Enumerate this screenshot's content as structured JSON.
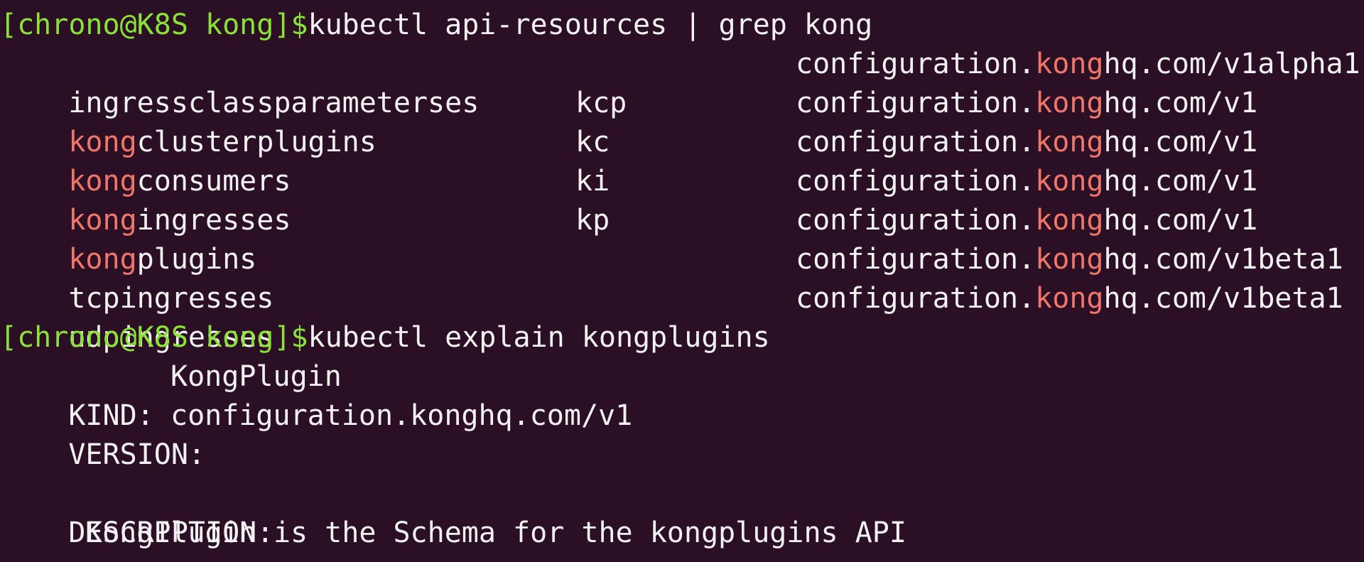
{
  "colors": {
    "background": "#2b0f24",
    "text": "#f2f2f2",
    "prompt": "#8ae234",
    "match_highlight": "#f0766a"
  },
  "prompt": "[chrono@K8S kong]$",
  "command1": "kubectl api-resources | grep kong",
  "match": "kong",
  "rows": [
    {
      "pre": "ingressclassparameterses",
      "name_match": "",
      "name_rest": "",
      "short": "",
      "api_pre": "configuration.",
      "api_match": "kong",
      "api_rest": "hq.com/v1alpha1"
    },
    {
      "pre": "",
      "name_match": "kong",
      "name_rest": "clusterplugins",
      "short": "kcp",
      "api_pre": "configuration.",
      "api_match": "kong",
      "api_rest": "hq.com/v1"
    },
    {
      "pre": "",
      "name_match": "kong",
      "name_rest": "consumers",
      "short": "kc",
      "api_pre": "configuration.",
      "api_match": "kong",
      "api_rest": "hq.com/v1"
    },
    {
      "pre": "",
      "name_match": "kong",
      "name_rest": "ingresses",
      "short": "ki",
      "api_pre": "configuration.",
      "api_match": "kong",
      "api_rest": "hq.com/v1"
    },
    {
      "pre": "",
      "name_match": "kong",
      "name_rest": "plugins",
      "short": "kp",
      "api_pre": "configuration.",
      "api_match": "kong",
      "api_rest": "hq.com/v1"
    },
    {
      "pre": "tcpingresses",
      "name_match": "",
      "name_rest": "",
      "short": "",
      "api_pre": "configuration.",
      "api_match": "kong",
      "api_rest": "hq.com/v1beta1"
    },
    {
      "pre": "udpingresses",
      "name_match": "",
      "name_rest": "",
      "short": "",
      "api_pre": "configuration.",
      "api_match": "kong",
      "api_rest": "hq.com/v1beta1"
    }
  ],
  "command2": "kubectl explain kongplugins",
  "explain": {
    "kind_label": "KIND:",
    "kind_value": "KongPlugin",
    "version_label": "VERSION:",
    "version_value": "configuration.konghq.com/v1",
    "description_label": "DESCRIPTION:",
    "description_text": "KongPlugin is the Schema for the kongplugins API"
  }
}
